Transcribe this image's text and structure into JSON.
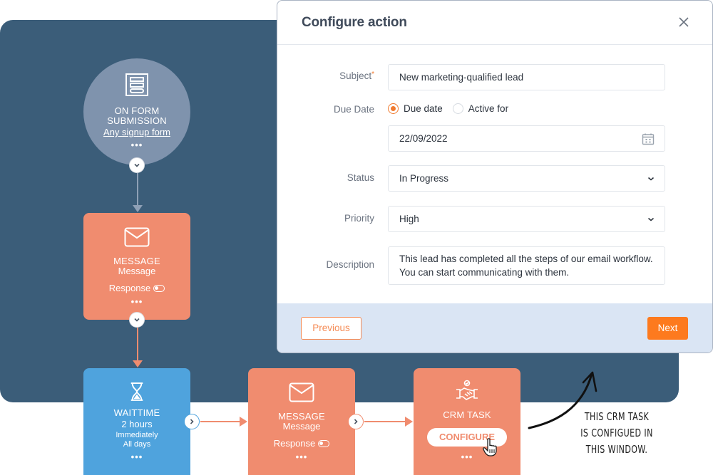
{
  "workflow": {
    "trigger": {
      "icon": "form-icon",
      "title_line1": "ON FORM",
      "title_line2": "SUBMISSION",
      "link": "Any signup form",
      "more": "•••"
    },
    "message1": {
      "icon": "envelope-icon",
      "title": "MESSAGE",
      "subtitle": "Message",
      "response_label": "Response",
      "more": "•••"
    },
    "waittime": {
      "icon": "hourglass-icon",
      "title": "WAITTIME",
      "duration": "2 hours",
      "timing": "Immediately",
      "days": "All days",
      "more": "•••"
    },
    "message2": {
      "icon": "envelope-icon",
      "title": "MESSAGE",
      "subtitle": "Message",
      "response_label": "Response",
      "more": "•••"
    },
    "crm_task": {
      "icon": "handshake-check-icon",
      "title": "CRM TASK",
      "configure_label": "CONFIGURE",
      "more": "•••"
    }
  },
  "modal": {
    "title": "Configure action",
    "fields": {
      "subject": {
        "label": "Subject",
        "required_mark": "*",
        "value": "New marketing-qualified lead"
      },
      "due_date": {
        "label": "Due Date",
        "options": [
          "Due date",
          "Active for"
        ],
        "selected": "Due date",
        "date_value": "22/09/2022"
      },
      "status": {
        "label": "Status",
        "value": "In Progress"
      },
      "priority": {
        "label": "Priority",
        "value": "High"
      },
      "description": {
        "label": "Description",
        "value": "This lead has completed all the steps of our email workflow. You can start communicating with them."
      }
    },
    "footer": {
      "previous_label": "Previous",
      "next_label": "Next"
    }
  },
  "annotation": {
    "line1": "This CRM task",
    "line2": "is configued in",
    "line3": "this window."
  },
  "colors": {
    "canvas": "#3b5d79",
    "trigger": "#7f93ad",
    "orange_card": "#f08c6f",
    "blue_card": "#4fa3dd",
    "accent": "#fd7a1e",
    "footer": "#dae5f4"
  }
}
